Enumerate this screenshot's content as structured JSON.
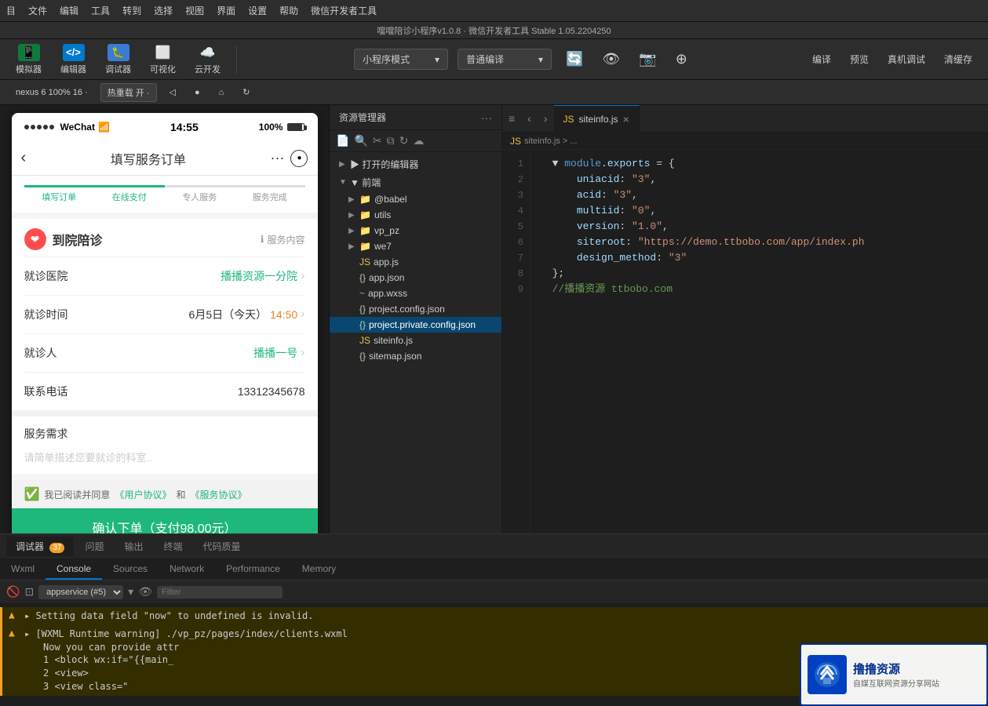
{
  "title": "噹噹陪诊小程序v1.0.8 · 微信开发者工具 Stable 1.05.2204250",
  "menubar": {
    "items": [
      "目",
      "文件",
      "编辑",
      "工具",
      "转到",
      "选择",
      "视图",
      "界面",
      "设置",
      "帮助",
      "微信开发者工具"
    ]
  },
  "toolbar": {
    "simulator_label": "模拟器",
    "editor_label": "编辑器",
    "debugger_label": "调试器",
    "visual_label": "可视化",
    "cloud_label": "云开发",
    "mode_label": "小程序模式",
    "compile_label": "普通编译",
    "compile_btn": "编译",
    "preview_btn": "预览",
    "real_btn": "真机调试",
    "clear_btn": "清缓存"
  },
  "secondary_toolbar": {
    "device": "nexus 6 100% 16 ·",
    "hotreload": "热重载 开 ·"
  },
  "file_explorer": {
    "title": "资源管理器",
    "section_open": "▶ 打开的编辑器",
    "section_frontend": "▼ 前端",
    "items": [
      {
        "name": "@babel",
        "type": "folder",
        "indent": 2
      },
      {
        "name": "utils",
        "type": "folder",
        "indent": 2
      },
      {
        "name": "vp_pz",
        "type": "folder",
        "indent": 2
      },
      {
        "name": "we7",
        "type": "folder",
        "indent": 2
      },
      {
        "name": "app.js",
        "type": "js",
        "indent": 2
      },
      {
        "name": "app.json",
        "type": "json",
        "indent": 2
      },
      {
        "name": "app.wxss",
        "type": "wxss",
        "indent": 2
      },
      {
        "name": "project.config.json",
        "type": "json",
        "indent": 2
      },
      {
        "name": "project.private.config.json",
        "type": "json",
        "indent": 2,
        "active": true
      },
      {
        "name": "siteinfo.js",
        "type": "js",
        "indent": 2
      },
      {
        "name": "sitemap.json",
        "type": "json",
        "indent": 2
      }
    ]
  },
  "editor": {
    "tab_label": "siteinfo.js",
    "breadcrumb": "siteinfo.js > ...",
    "code_lines": [
      {
        "num": 1,
        "text": "  module.exports = {"
      },
      {
        "num": 2,
        "text": "      uniacid: \"3\","
      },
      {
        "num": 3,
        "text": "      acid: \"3\","
      },
      {
        "num": 4,
        "text": "      multiid: \"0\","
      },
      {
        "num": 5,
        "text": "      version: \"1.0\","
      },
      {
        "num": 6,
        "text": "      siteroot: \"https://demo.ttbobo.com/app/index.ph"
      },
      {
        "num": 7,
        "text": "      design_method: \"3\""
      },
      {
        "num": 8,
        "text": "  };"
      },
      {
        "num": 9,
        "text": "  //播播资源 ttbobo.com"
      }
    ]
  },
  "devtools": {
    "tabs": [
      {
        "label": "调试器",
        "badge": "37"
      },
      {
        "label": "问题"
      },
      {
        "label": "输出"
      },
      {
        "label": "终端"
      },
      {
        "label": "代码质量"
      }
    ],
    "nav_tabs": [
      "Wxml",
      "Console",
      "Sources",
      "Network",
      "Performance",
      "Memory"
    ],
    "active_nav": "Console",
    "toolbar": {
      "select_value": "appservice (#5)",
      "filter_placeholder": "Filter"
    },
    "console_lines": [
      {
        "type": "warning",
        "text": "▸ Setting data field \"now\" to undefined is invalid."
      },
      {
        "type": "warning",
        "text": "▸ [WXML Runtime warning] ./vp_pz/pages/index/clients.wxml",
        "sub1": "  Now you can provide attr",
        "sub2": "  1    <block wx:if=\"{{main_",
        "sub3": "  2      <view>",
        "sub4": "  3        <view class=\""
      }
    ]
  },
  "phone": {
    "status": {
      "signal": "WeChat",
      "time": "14:55",
      "battery": "100%"
    },
    "nav": {
      "title": "填写服务订单"
    },
    "steps": [
      "填写订单",
      "在线支付",
      "专人服务",
      "服务完成"
    ],
    "section_title": "到院陪诊",
    "service_content_btn": "服务内容",
    "fields": [
      {
        "label": "就诊医院",
        "value": "播播资源一分院",
        "has_arrow": true
      },
      {
        "label": "就诊时间",
        "value": "6月5日（今天）14:50",
        "has_arrow": true,
        "highlight": "14:50"
      },
      {
        "label": "就诊人",
        "value": "播播一号",
        "has_arrow": true
      },
      {
        "label": "联系电话",
        "value": "13312345678",
        "has_arrow": false
      }
    ],
    "service_demand": {
      "title": "服务需求",
      "placeholder": "请简单描述您要就诊的科室.."
    },
    "agreement": {
      "text": "我已阅读并同意",
      "links": [
        "《用户协议》",
        "和",
        "《服务协议》"
      ]
    },
    "submit_btn": "确认下单（支付98.00元）"
  },
  "watermark": {
    "title": "撸撸资源",
    "sub": "自媒互联网资源分享网站"
  }
}
